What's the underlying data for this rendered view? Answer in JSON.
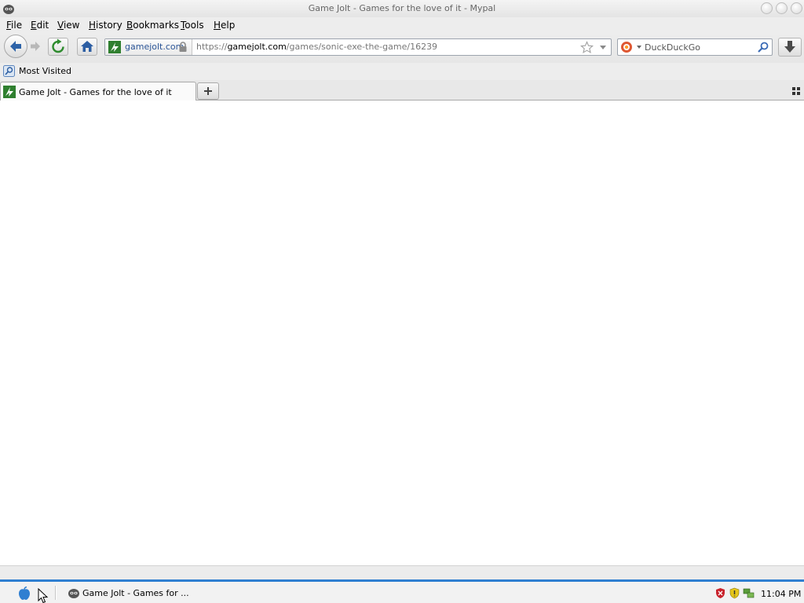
{
  "window": {
    "title": "Game Jolt - Games for the love of it - Mypal",
    "controls": [
      "minimize",
      "maximize",
      "close"
    ]
  },
  "menu": {
    "items": [
      "File",
      "Edit",
      "View",
      "History",
      "Bookmarks",
      "Tools",
      "Help"
    ]
  },
  "navigation": {
    "identity_domain": "gamejolt.com",
    "url_prefix": "https://",
    "url_host": "gamejolt.com",
    "url_path": "/games/sonic-exe-the-game/16239",
    "search_placeholder": "DuckDuckGo"
  },
  "bookmarks": {
    "items": [
      {
        "label": "Most Visited",
        "icon": "most-visited-icon"
      }
    ]
  },
  "tabs": [
    {
      "label": "Game Jolt - Games for the love of it",
      "active": true,
      "icon": "gamejolt-favicon"
    }
  ],
  "taskbar": {
    "task_label": "Game Jolt - Games for ...",
    "clock": "11:04 PM",
    "tray_icons": [
      "shield-red-icon",
      "shield-yellow-icon",
      "network-icon"
    ]
  },
  "colors": {
    "taskbar_accent": "#2f7fd1",
    "link_blue": "#2b5597",
    "gamejolt_green": "#2f7f2f"
  }
}
